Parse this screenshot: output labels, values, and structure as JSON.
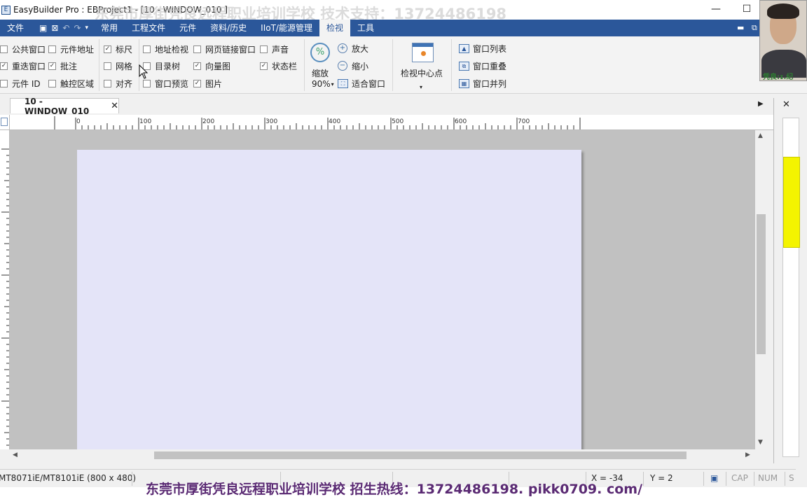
{
  "titlebar": {
    "title": "EasyBuilder Pro : EBProject1 - [10 - WINDOW_010 ]",
    "watermark": "东莞市厚街凭良远程职业培训学校  技术支持：13724486198",
    "minimize": "—",
    "maximize": "☐",
    "close": "✕"
  },
  "menu": {
    "items": [
      "文件",
      "常用",
      "工程文件",
      "元件",
      "资料/历史",
      "IIoT/能源管理",
      "检视",
      "工具"
    ],
    "active": "检视",
    "mdi_min": "▬",
    "mdi_restore": "⧉",
    "mdi_close": "✕"
  },
  "ribbon": {
    "checkboxes": [
      {
        "label": "公共窗口",
        "checked": false
      },
      {
        "label": "元件地址",
        "checked": false
      },
      {
        "label": "标尺",
        "checked": true
      },
      {
        "label": "地址检视",
        "checked": false
      },
      {
        "label": "网页链接窗口",
        "checked": false
      },
      {
        "label": "声音",
        "checked": false
      },
      {
        "label": "重迭窗口",
        "checked": true
      },
      {
        "label": "批注",
        "checked": true
      },
      {
        "label": "网格",
        "checked": false
      },
      {
        "label": "目录树",
        "checked": false
      },
      {
        "label": "向量图",
        "checked": true
      },
      {
        "label": "状态栏",
        "checked": true
      },
      {
        "label": "元件 ID",
        "checked": false
      },
      {
        "label": "触控区域",
        "checked": false
      },
      {
        "label": "对齐",
        "checked": false
      },
      {
        "label": "窗口预览",
        "checked": false
      },
      {
        "label": "图片",
        "checked": true
      }
    ],
    "zoom": {
      "label": "缩放",
      "value": "90%",
      "zoom_in": "放大",
      "zoom_out": "缩小",
      "fit": "适合窗口"
    },
    "center": {
      "label": "检视中心点"
    },
    "window_list": "窗口列表",
    "cascade": "窗口重叠",
    "tile": "窗口并列"
  },
  "document": {
    "tab_label": "10 - WINDOW_010",
    "tab_close": "✕",
    "ruler_labels": [
      "0",
      "100",
      "200",
      "300",
      "400",
      "500",
      "600",
      "700"
    ]
  },
  "statusbar": {
    "model": "MT8071iE/MT8101iE (800 x 480)",
    "x": "X = -34",
    "y": "Y = 2",
    "cap": "CAP",
    "num": "NUM",
    "scrl": "S"
  },
  "bottom_watermark": "东莞市厚街凭良远程职业培训学校  招生热线：13724486198. pikk0709. com/",
  "avatar_caption": "凭良:ɪ.纪"
}
